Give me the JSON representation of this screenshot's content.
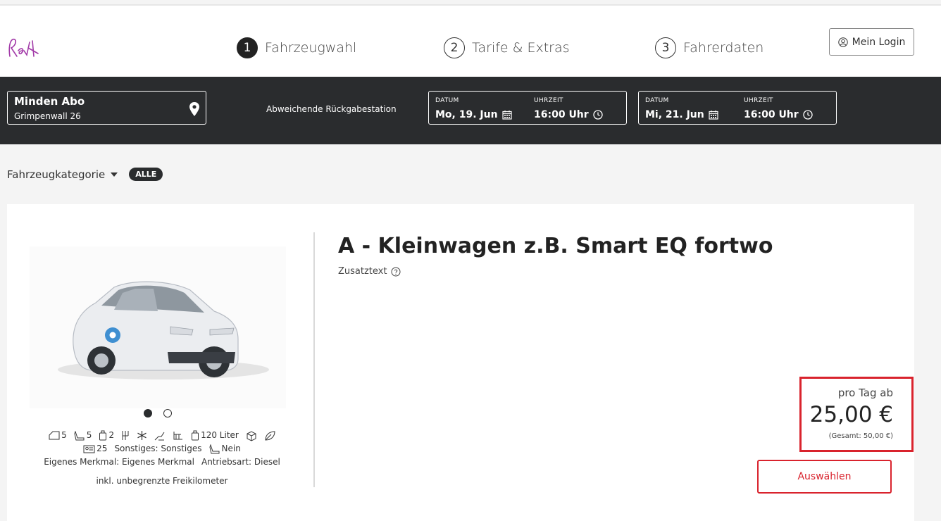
{
  "header": {
    "steps": [
      {
        "num": "1",
        "label": "Fahrzeugwahl"
      },
      {
        "num": "2",
        "label": "Tarife & Extras"
      },
      {
        "num": "3",
        "label": "Fahrerdaten"
      }
    ],
    "login_label": "Mein Login"
  },
  "bar": {
    "location_name": "Minden Abo",
    "location_street": "Grimpenwall 26",
    "return_label": "Abweichende Rückgabestation",
    "pickup": {
      "date_label": "DATUM",
      "date": "Mo, 19. Jun",
      "time_label": "UHRZEIT",
      "time": "16:00 Uhr"
    },
    "dropoff": {
      "date_label": "DATUM",
      "date": "Mi, 21. Jun",
      "time_label": "UHRZEIT",
      "time": "16:00 Uhr"
    }
  },
  "filter": {
    "label": "Fahrzeugkategorie",
    "badge": "ALLE"
  },
  "vehicle": {
    "title": "A - Kleinwagen z.B. Smart EQ fortwo",
    "subtext": "Zusatztext",
    "specs": {
      "doors": "5",
      "seats": "5",
      "bags": "2",
      "tank": "120 Liter",
      "min_age": "25",
      "other": "Sonstiges: Sonstiges",
      "extra_seat": "Nein",
      "own_feature": "Eigenes Merkmal: Eigenes Merkmal",
      "drive": "Antriebsart: Diesel"
    },
    "mileage": "inkl. unbegrenzte Freikilometer",
    "price_per_day_label": "pro Tag ab",
    "price": "25,00 €",
    "total": "(Gesamt: 50,00 €)",
    "select_label": "Auswählen"
  },
  "colors": {
    "accent": "#d9232d",
    "dark_bar": "#2a2c2e"
  }
}
